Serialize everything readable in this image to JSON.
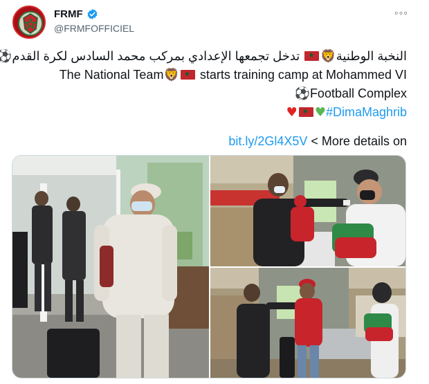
{
  "account": {
    "display_name": "FRMF",
    "handle": "@FRMFOFFICIEL",
    "verified_icon": "verified-badge-icon",
    "avatar_icon": "frmf-crest-icon"
  },
  "menu": {
    "more_icon": "more-horizontal-icon",
    "more_glyph": "◦◦◦"
  },
  "tweet": {
    "arabic_part1": "النخبة الوطنية",
    "arabic_part2": "تدخل تجمعها الإعدادي بمركب محمد السادس لكرة القدم",
    "english_part1": "The National Team",
    "english_part2": "starts training camp at Mohammed VI",
    "english_part3": "Football Complex",
    "hashtag": "#DimaMaghrib",
    "link_url": "bit.ly/2Gl4X5V",
    "link_suffix": " < More details on"
  },
  "emoji": {
    "lion": "🦁",
    "soccer_ball": "⚽",
    "red_heart": "♥",
    "green_heart": "♥"
  },
  "colors": {
    "link_blue": "#1d9bf0",
    "flag_red": "#c1272d",
    "flag_green": "#006233"
  },
  "media": {
    "photos": [
      {
        "name": "team-arrival-photo"
      },
      {
        "name": "temperature-check-photo-1"
      },
      {
        "name": "temperature-check-photo-2"
      }
    ]
  }
}
